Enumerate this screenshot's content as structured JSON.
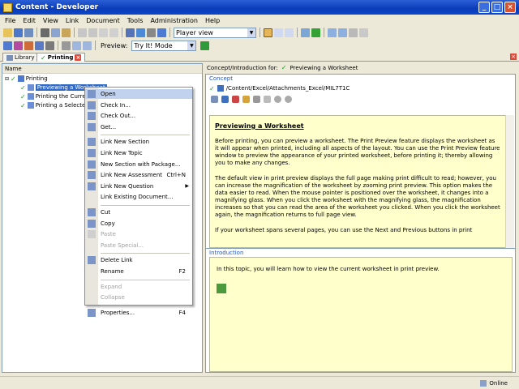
{
  "title": "Content - Developer",
  "menu": [
    "File",
    "Edit",
    "View",
    "Link",
    "Document",
    "Tools",
    "Administration",
    "Help"
  ],
  "toolbar": {
    "view_value": "Player view",
    "preview_label": "Preview:",
    "preview_value": "Try It! Mode"
  },
  "tabs": [
    {
      "label": "Library",
      "active": false
    },
    {
      "label": "Printing",
      "active": true
    }
  ],
  "left": {
    "column_header": "Name",
    "root": "Printing",
    "items": [
      "Previewing a Worksheet",
      "Printing the Current",
      "Printing a Selected"
    ]
  },
  "context_menu": [
    {
      "label": "Open",
      "shortcut": "",
      "disabled": false,
      "hl": true,
      "icon": "open-icon"
    },
    {
      "label": "Check In...",
      "shortcut": "",
      "disabled": false,
      "icon": "check-in-icon"
    },
    {
      "label": "Check Out...",
      "shortcut": "",
      "disabled": false,
      "icon": "check-out-icon"
    },
    {
      "label": "Get...",
      "shortcut": "",
      "disabled": false,
      "icon": "get-icon"
    },
    {
      "sep": true
    },
    {
      "label": "Link New Section",
      "shortcut": "",
      "disabled": false,
      "icon": "section-icon"
    },
    {
      "label": "Link New Topic",
      "shortcut": "",
      "disabled": false,
      "icon": "topic-icon"
    },
    {
      "label": "New Section with Package...",
      "shortcut": "",
      "disabled": false,
      "icon": "package-icon"
    },
    {
      "label": "Link New Assessment",
      "shortcut": "Ctrl+N",
      "disabled": false,
      "icon": "assessment-icon"
    },
    {
      "label": "Link New Question",
      "shortcut": "",
      "disabled": false,
      "submenu": true,
      "icon": "question-icon"
    },
    {
      "label": "Link Existing Document...",
      "shortcut": "",
      "disabled": false,
      "icon": ""
    },
    {
      "sep": true
    },
    {
      "label": "Cut",
      "shortcut": "",
      "disabled": false,
      "icon": "cut-icon"
    },
    {
      "label": "Copy",
      "shortcut": "",
      "disabled": false,
      "icon": "copy-icon"
    },
    {
      "label": "Paste",
      "shortcut": "",
      "disabled": true,
      "icon": "paste-icon"
    },
    {
      "label": "Paste Special...",
      "shortcut": "",
      "disabled": true,
      "icon": ""
    },
    {
      "sep": true
    },
    {
      "label": "Delete Link",
      "shortcut": "",
      "disabled": false,
      "icon": "delete-icon"
    },
    {
      "label": "Rename",
      "shortcut": "F2",
      "disabled": false,
      "icon": ""
    },
    {
      "sep": true
    },
    {
      "label": "Expand",
      "shortcut": "",
      "disabled": true,
      "icon": ""
    },
    {
      "label": "Collapse",
      "shortcut": "",
      "disabled": true,
      "icon": ""
    },
    {
      "sep": true
    },
    {
      "label": "Properties...",
      "shortcut": "F4",
      "disabled": false,
      "icon": "properties-icon"
    }
  ],
  "right": {
    "header_label": "Concept/Introduction for:",
    "header_doc": "Previewing a Worksheet",
    "concept_title": "Concept",
    "concept_path": "/Content/Excel/Attachments_Excel/MIL7T1C",
    "heading": "Previewing a Worksheet",
    "p1": "Before printing, you can preview a worksheet. The Print Preview feature displays the worksheet as it will appear when printed, including all aspects of the layout. You can use the Print Preview feature window to preview the appearance of your printed worksheet, before printing it; thereby allowing you to make any changes.",
    "p2": "The default view in print preview displays the full page making print difficult to read; however, you can increase the magnification of the worksheet by zooming print preview. This option makes the data easier to read. When the mouse pointer is positioned over the worksheet, it changes into a magnifying glass. When you click the worksheet with the magnifying glass, the magnification increases so that you can read the area of the worksheet you clicked. When you click the worksheet again, the magnification returns to full page view.",
    "p3": "If your worksheet spans several pages, you can use the Next and Previous buttons in print",
    "intro_title": "Introduction",
    "intro_text": "In this topic, you will learn how to view the current worksheet in print preview."
  },
  "status": "Online"
}
